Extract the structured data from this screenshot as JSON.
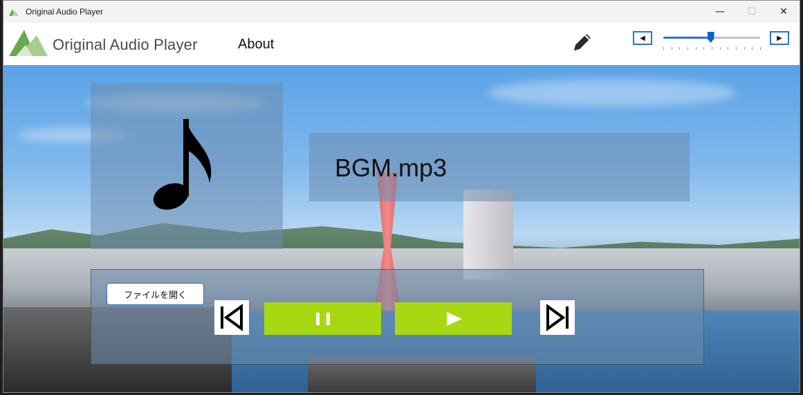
{
  "window": {
    "title": "Original Audio Player",
    "icons": {
      "app": "app-logo-icon",
      "minimize": "minimize-icon",
      "maximize": "maximize-icon",
      "close": "close-icon"
    }
  },
  "header": {
    "app_name": "Original Audio Player",
    "about_label": "About",
    "edit_icon": "pencil-icon",
    "volume": {
      "decrease_label": "◀",
      "increase_label": "▶",
      "level_fraction": 0.49,
      "accent_color": "#2a74c2"
    }
  },
  "artwork": {
    "icon": "music-note-icon"
  },
  "now_playing": {
    "track_name": "BGM.mp3"
  },
  "controls": {
    "open_file_label": "ファイルを開く",
    "prev_icon": "skip-previous-icon",
    "pause_icon": "pause-icon",
    "play_icon": "play-icon",
    "next_icon": "skip-next-icon",
    "button_color": "#a8d812"
  }
}
